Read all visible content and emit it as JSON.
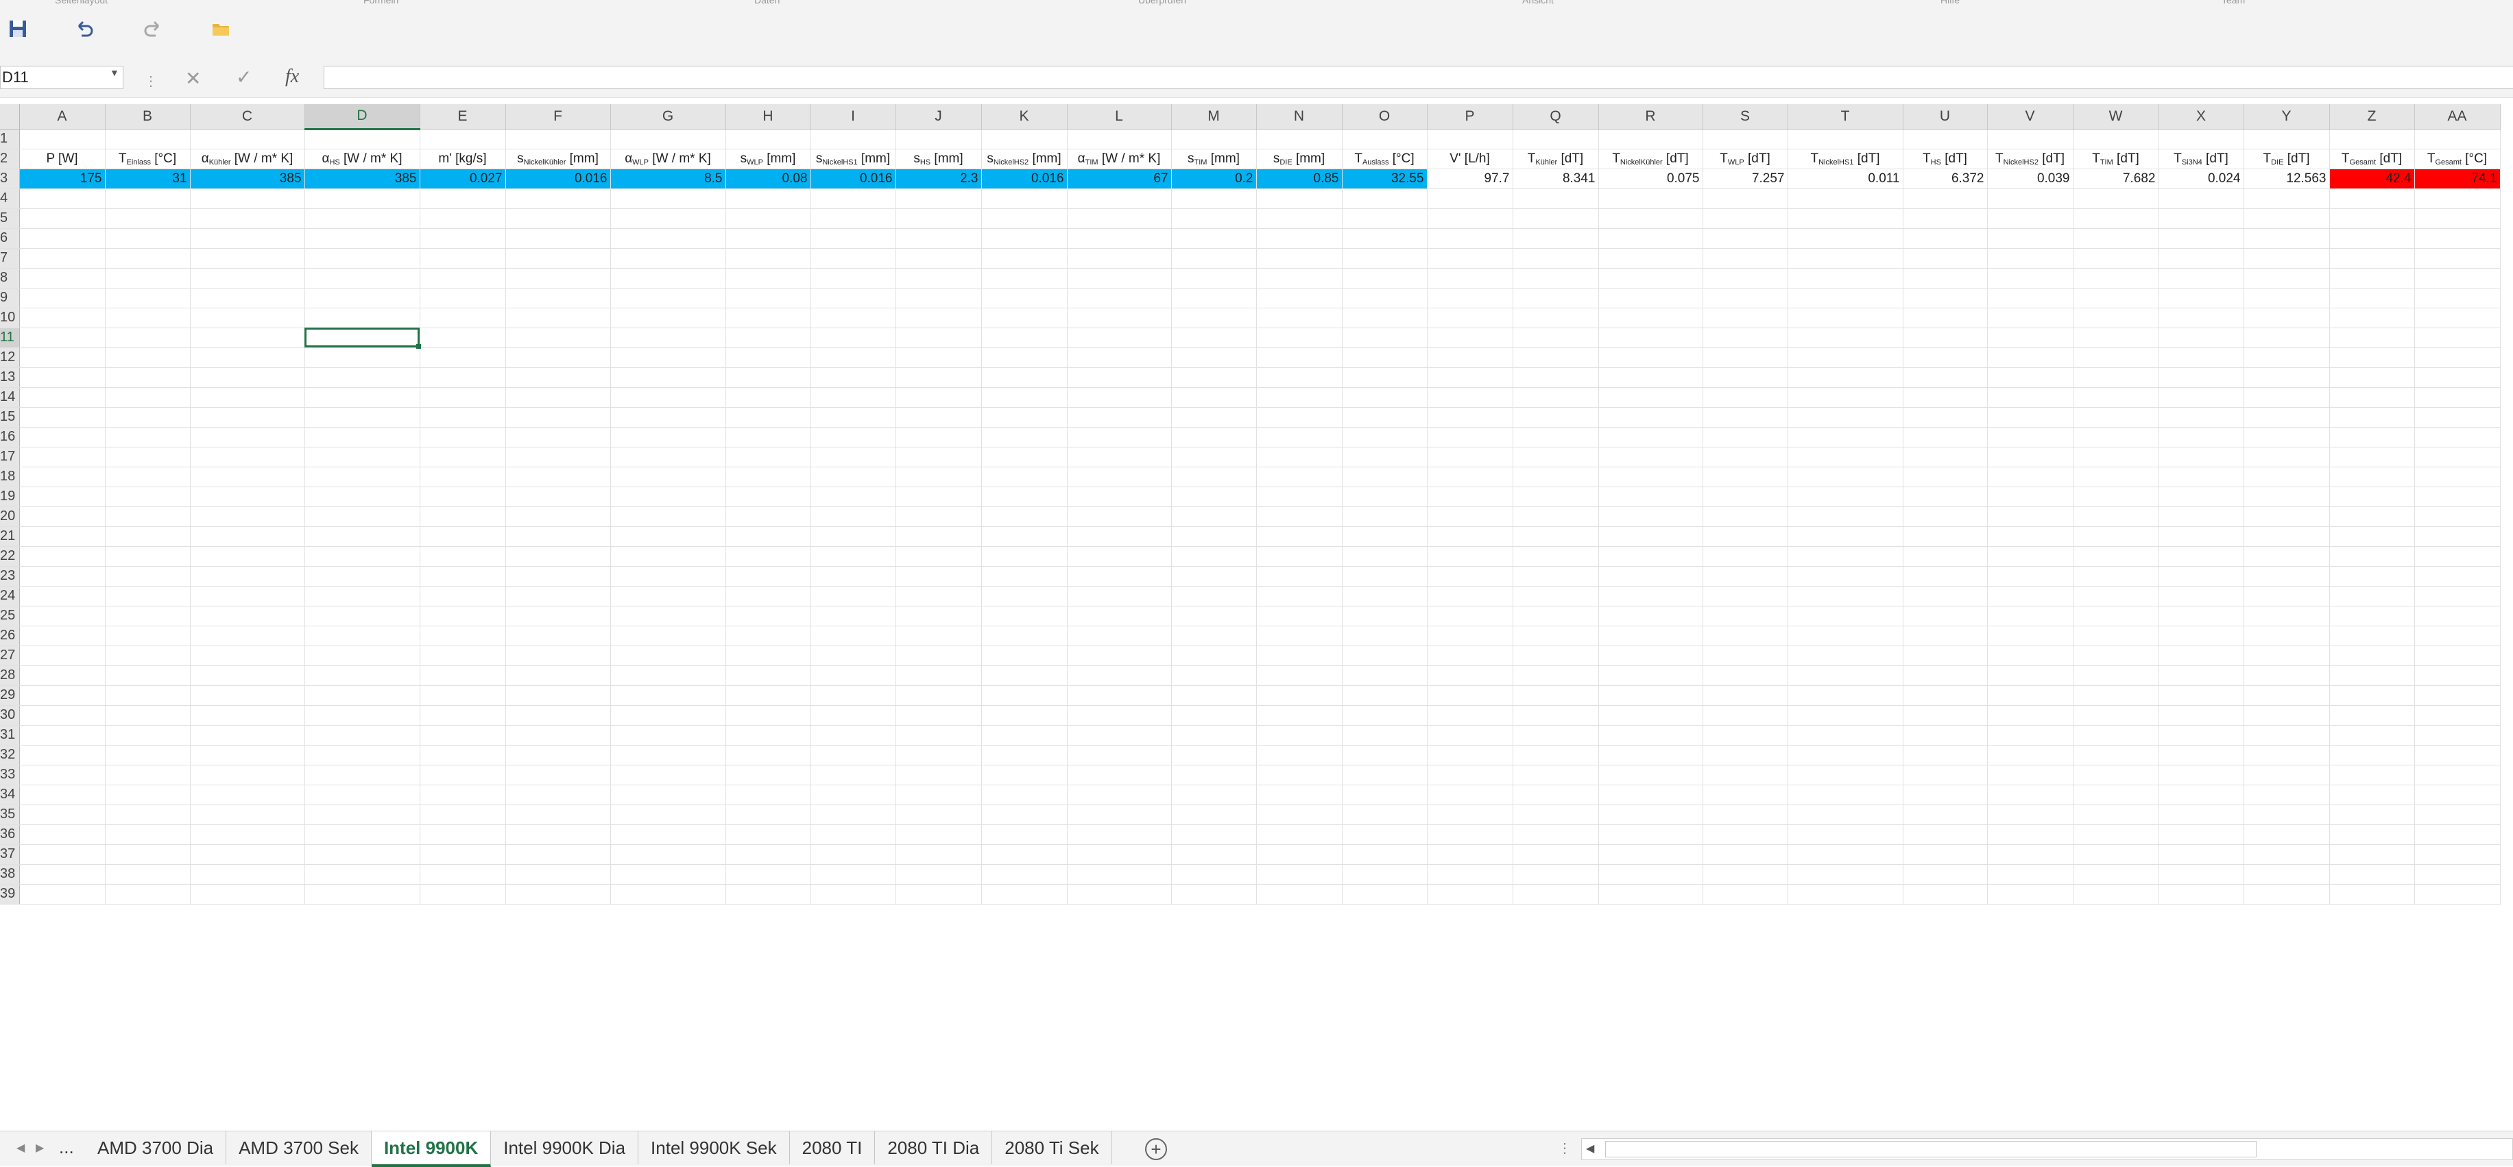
{
  "toolbar": {
    "ribbon_remnants": [
      "Seitenlayout",
      "Formeln",
      "Daten",
      "Überprüfen",
      "Ansicht",
      "Hilfe",
      "Team"
    ],
    "icons": [
      "save-icon",
      "undo-icon",
      "redo-icon",
      "open-folder-icon"
    ]
  },
  "formula_bar": {
    "name_box": "D11",
    "formula": "",
    "cancel_glyph": "✕",
    "enter_glyph": "✓",
    "fx_label": "fx",
    "separator": "⋮"
  },
  "grid": {
    "active_cell": "D11",
    "columns": [
      "A",
      "B",
      "C",
      "D",
      "E",
      "F",
      "G",
      "H",
      "I",
      "J",
      "K",
      "L",
      "M",
      "N",
      "O",
      "P",
      "Q",
      "R",
      "S",
      "T",
      "U",
      "V",
      "W",
      "X",
      "Y",
      "Z",
      "AA"
    ],
    "row_numbers": [
      "1",
      "2",
      "3",
      "4",
      "5",
      "6",
      "7",
      "8",
      "9",
      "10",
      "11",
      "12",
      "13",
      "14",
      "15",
      "16",
      "17",
      "18",
      "19",
      "20",
      "21",
      "22",
      "23",
      "24",
      "25",
      "26",
      "27",
      "28",
      "29",
      "30",
      "31",
      "32",
      "33",
      "34",
      "35",
      "36",
      "37",
      "38",
      "39"
    ],
    "header_row": [
      {
        "base": "P [W]",
        "sub": "",
        "unit": ""
      },
      {
        "base": "T",
        "sub": "Einlass",
        "unit": " [°C]"
      },
      {
        "base": "α",
        "sub": "Kühler",
        "unit": " [W / m* K]"
      },
      {
        "base": "α",
        "sub": "HS",
        "unit": " [W / m* K]"
      },
      {
        "base": "m' [kg/s]",
        "sub": "",
        "unit": ""
      },
      {
        "base": "s",
        "sub": "NickelKühler",
        "unit": " [mm]"
      },
      {
        "base": "α",
        "sub": "WLP",
        "unit": " [W / m* K]"
      },
      {
        "base": "s",
        "sub": "WLP",
        "unit": " [mm]"
      },
      {
        "base": "s",
        "sub": "NickelHS1",
        "unit": " [mm]"
      },
      {
        "base": "s",
        "sub": "HS",
        "unit": " [mm]"
      },
      {
        "base": "s",
        "sub": "NickelHS2",
        "unit": " [mm]"
      },
      {
        "base": "α",
        "sub": "TIM",
        "unit": " [W / m* K]"
      },
      {
        "base": "s",
        "sub": "TIM",
        "unit": " [mm]"
      },
      {
        "base": "s",
        "sub": "DIE",
        "unit": " [mm]"
      },
      {
        "base": "T",
        "sub": "Auslass",
        "unit": " [°C]"
      },
      {
        "base": "V' [L/h]",
        "sub": "",
        "unit": ""
      },
      {
        "base": "T",
        "sub": "Kühler",
        "unit": " [dT]"
      },
      {
        "base": "T",
        "sub": "NickelKühler",
        "unit": " [dT]"
      },
      {
        "base": "T",
        "sub": "WLP",
        "unit": " [dT]"
      },
      {
        "base": "T",
        "sub": "NickelHS1",
        "unit": " [dT]"
      },
      {
        "base": "T",
        "sub": "HS",
        "unit": " [dT]"
      },
      {
        "base": "T",
        "sub": "NickelHS2",
        "unit": " [dT]"
      },
      {
        "base": "T",
        "sub": "TIM",
        "unit": " [dT]"
      },
      {
        "base": "T",
        "sub": "Si3N4",
        "unit": " [dT]"
      },
      {
        "base": "T",
        "sub": "DIE",
        "unit": " [dT]"
      },
      {
        "base": "T",
        "sub": "Gesamt",
        "unit": " [dT]"
      },
      {
        "base": "T",
        "sub": "Gesamt",
        "unit": " [°C]"
      }
    ],
    "value_row": [
      "175",
      "31",
      "385",
      "385",
      "0.027",
      "0.016",
      "8.5",
      "0.08",
      "0.016",
      "2.3",
      "0.016",
      "67",
      "0.2",
      "0.85",
      "32.55",
      "97.7",
      "8.341",
      "0.075",
      "7.257",
      "0.011",
      "6.372",
      "0.039",
      "7.682",
      "0.024",
      "12.563",
      "42.4",
      "74.1"
    ],
    "highlight_colors": {
      "input_fill": "#00b0f0",
      "result_fill": "#ff0000",
      "selection": "#217346"
    }
  },
  "sheet_tabs": {
    "ellipsis": "...",
    "tabs": [
      "AMD 3700 Dia",
      "AMD 3700 Sek",
      "Intel 9900K",
      "Intel 9900K Dia",
      "Intel 9900K Sek",
      "2080 TI",
      "2080 TI Dia",
      "2080 Ti Sek"
    ],
    "active": "Intel 9900K",
    "add_glyph": "+"
  }
}
